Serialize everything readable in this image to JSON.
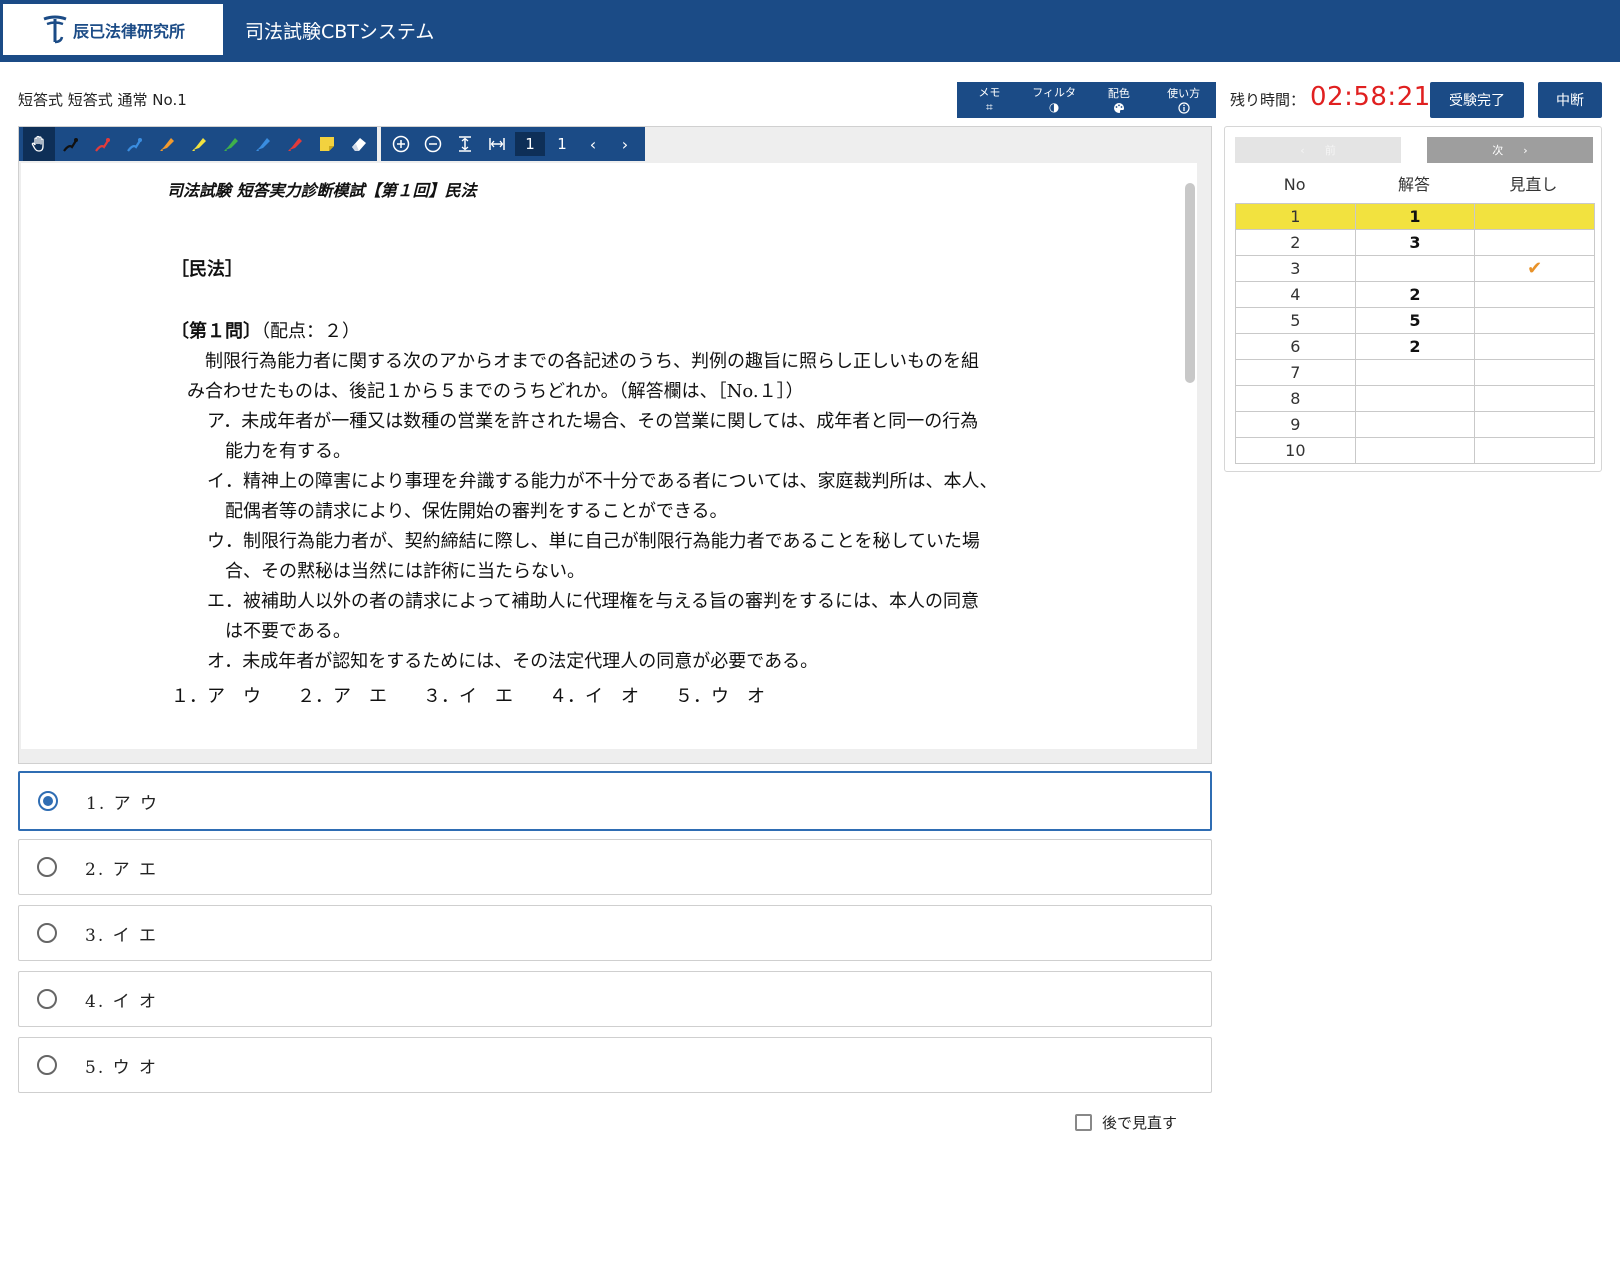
{
  "header": {
    "logo_text": "辰已法律研究所",
    "app_title": "司法試験CBTシステム"
  },
  "top": {
    "exam_label": "短答式 短答式 通常 No.1",
    "menu": [
      {
        "label": "メモ",
        "icon": "grid-icon"
      },
      {
        "label": "フィルタ",
        "icon": "contrast-icon"
      },
      {
        "label": "配色",
        "icon": "palette-icon"
      },
      {
        "label": "使い方",
        "icon": "info-icon"
      }
    ],
    "time_label": "残り時間：",
    "time_value": "02:58:21",
    "finish_button": "受験完了",
    "pause_button": "中断"
  },
  "viewer": {
    "page_current": "1",
    "page_total": "1",
    "tool_colors": {
      "pen_black": "#111111",
      "pen_red": "#e23b3b",
      "pen_blue": "#3a8de0",
      "marker_orange": "#f29a2e",
      "marker_yellow": "#f2e23f",
      "marker_green": "#3fb04a",
      "marker_blue": "#3a8de0",
      "marker_red": "#e23b3b",
      "sticky_yellow": "#f2d23f"
    }
  },
  "document": {
    "title": "司法試験 短答実力診断模試【第１回】民法",
    "section": "［民法］",
    "question_head": "〔第１問〕",
    "points": "（配点：２）",
    "lines": [
      "　制限行為能力者に関する次のアからオまでの各記述のうち、判例の趣旨に照らし正しいものを組",
      "み合わせたものは、後記１から５までのうちどれか。（解答欄は、［No.１］）",
      "ア．未成年者が一種又は数種の営業を許された場合、その営業に関しては、成年者と同一の行為",
      "　能力を有する。",
      "イ．精神上の障害により事理を弁識する能力が不十分である者については、家庭裁判所は、本人、",
      "　配偶者等の請求により、保佐開始の審判をすることができる。",
      "ウ．制限行為能力者が、契約締結に際し、単に自己が制限行為能力者であることを秘していた場",
      "　合、その黙秘は当然には詐術に当たらない。",
      "エ．被補助人以外の者の請求によって補助人に代理権を与える旨の審判をするには、本人の同意",
      "　は不要である。",
      "オ．未成年者が認知をするためには、その法定代理人の同意が必要である。"
    ],
    "choices_line": "１．ア　ウ　　２．ア　エ　　３．イ　エ　　４．イ　オ　　５．ウ　オ"
  },
  "options": [
    {
      "label": "1. ア ウ",
      "selected": true
    },
    {
      "label": "2. ア エ",
      "selected": false
    },
    {
      "label": "3. イ エ",
      "selected": false
    },
    {
      "label": "4. イ オ",
      "selected": false
    },
    {
      "label": "5. ウ オ",
      "selected": false
    }
  ],
  "review_later": "後で見直す",
  "side": {
    "prev_label": "前",
    "next_label": "次",
    "columns": [
      "No",
      "解答",
      "見直し"
    ],
    "rows": [
      {
        "no": "1",
        "answer": "1",
        "review": false,
        "current": true
      },
      {
        "no": "2",
        "answer": "3",
        "review": false,
        "current": false
      },
      {
        "no": "3",
        "answer": "",
        "review": true,
        "current": false
      },
      {
        "no": "4",
        "answer": "2",
        "review": false,
        "current": false
      },
      {
        "no": "5",
        "answer": "5",
        "review": false,
        "current": false
      },
      {
        "no": "6",
        "answer": "2",
        "review": false,
        "current": false
      },
      {
        "no": "7",
        "answer": "",
        "review": false,
        "current": false
      },
      {
        "no": "8",
        "answer": "",
        "review": false,
        "current": false
      },
      {
        "no": "9",
        "answer": "",
        "review": false,
        "current": false
      },
      {
        "no": "10",
        "answer": "",
        "review": false,
        "current": false
      }
    ]
  }
}
